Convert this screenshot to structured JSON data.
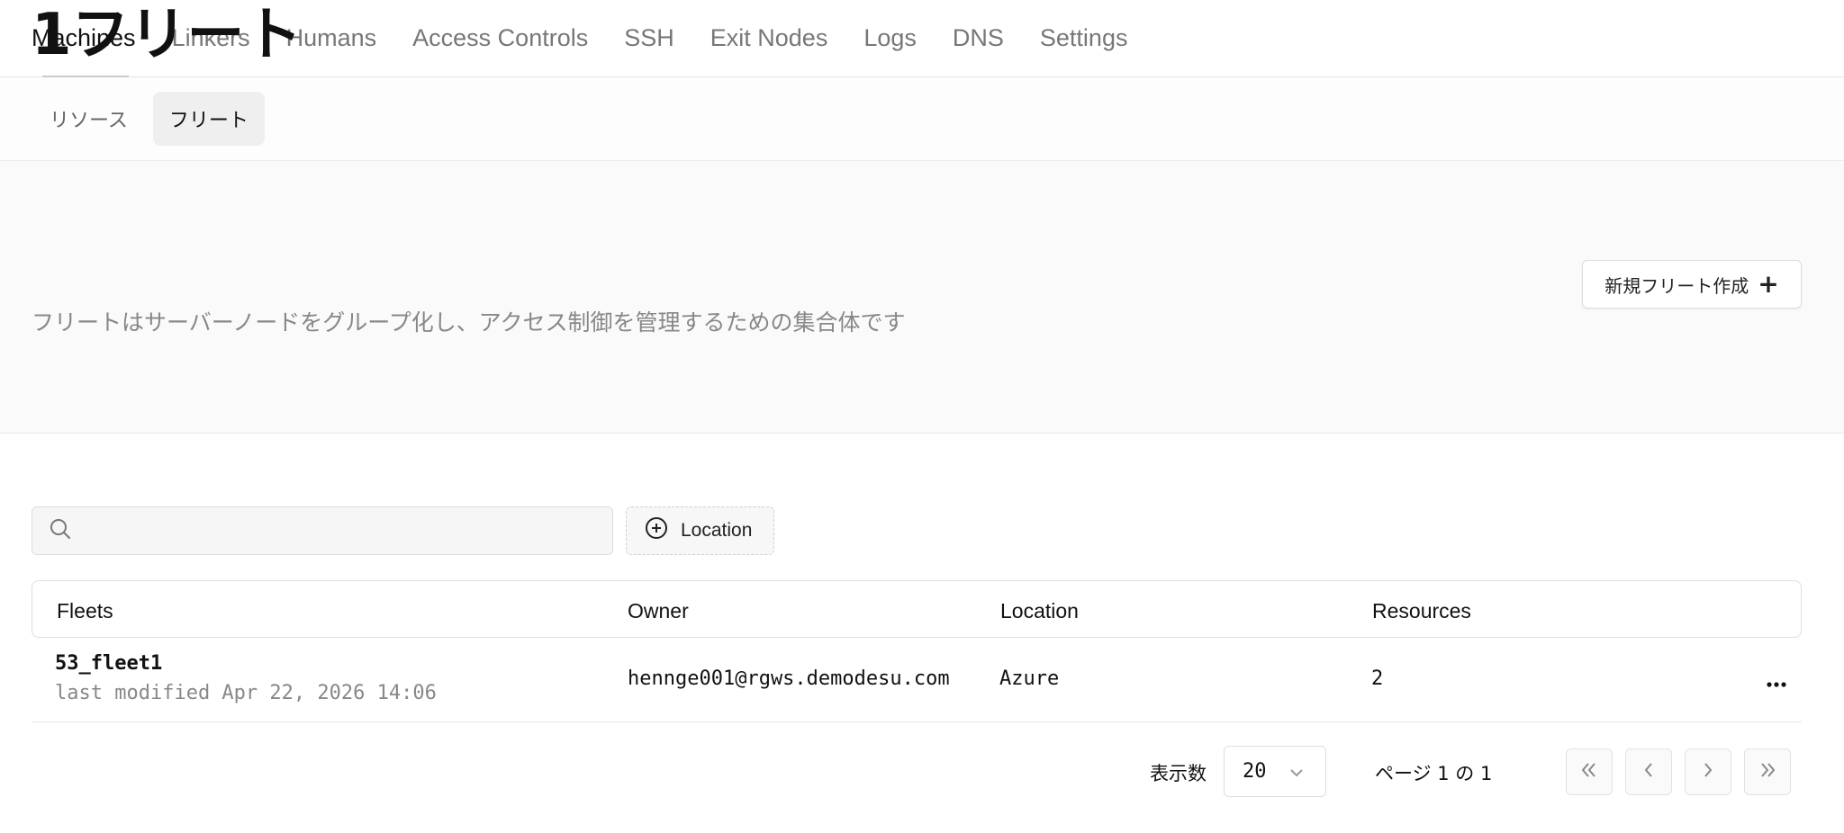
{
  "topnav": {
    "tabs": [
      {
        "label": "Machines",
        "active": true
      },
      {
        "label": "Linkers"
      },
      {
        "label": "Humans"
      },
      {
        "label": "Access Controls"
      },
      {
        "label": "SSH"
      },
      {
        "label": "Exit Nodes"
      },
      {
        "label": "Logs"
      },
      {
        "label": "DNS"
      },
      {
        "label": "Settings"
      }
    ]
  },
  "subtabs": [
    {
      "label": "リソース"
    },
    {
      "label": "フリート",
      "active": true
    }
  ],
  "header": {
    "title": "1フリート",
    "description": "フリートはサーバーノードをグループ化し、アクセス制御を管理するための集合体です",
    "create_button": "新規フリート作成"
  },
  "filters": {
    "search_placeholder": "",
    "location_filter": "Location"
  },
  "table": {
    "columns": [
      "Fleets",
      "Owner",
      "Location",
      "Resources"
    ],
    "rows": [
      {
        "name": "53_fleet1",
        "modified": "last modified Apr 22, 2026 14:06",
        "owner": "hennge001@rgws.demodesu.com",
        "location": "Azure",
        "resources": "2"
      }
    ]
  },
  "pagination": {
    "page_size_label": "表示数",
    "page_size": "20",
    "page_info": "ページ 1 の 1"
  },
  "colors": {
    "text": "#111111",
    "muted": "#888888",
    "border": "#dedede"
  }
}
